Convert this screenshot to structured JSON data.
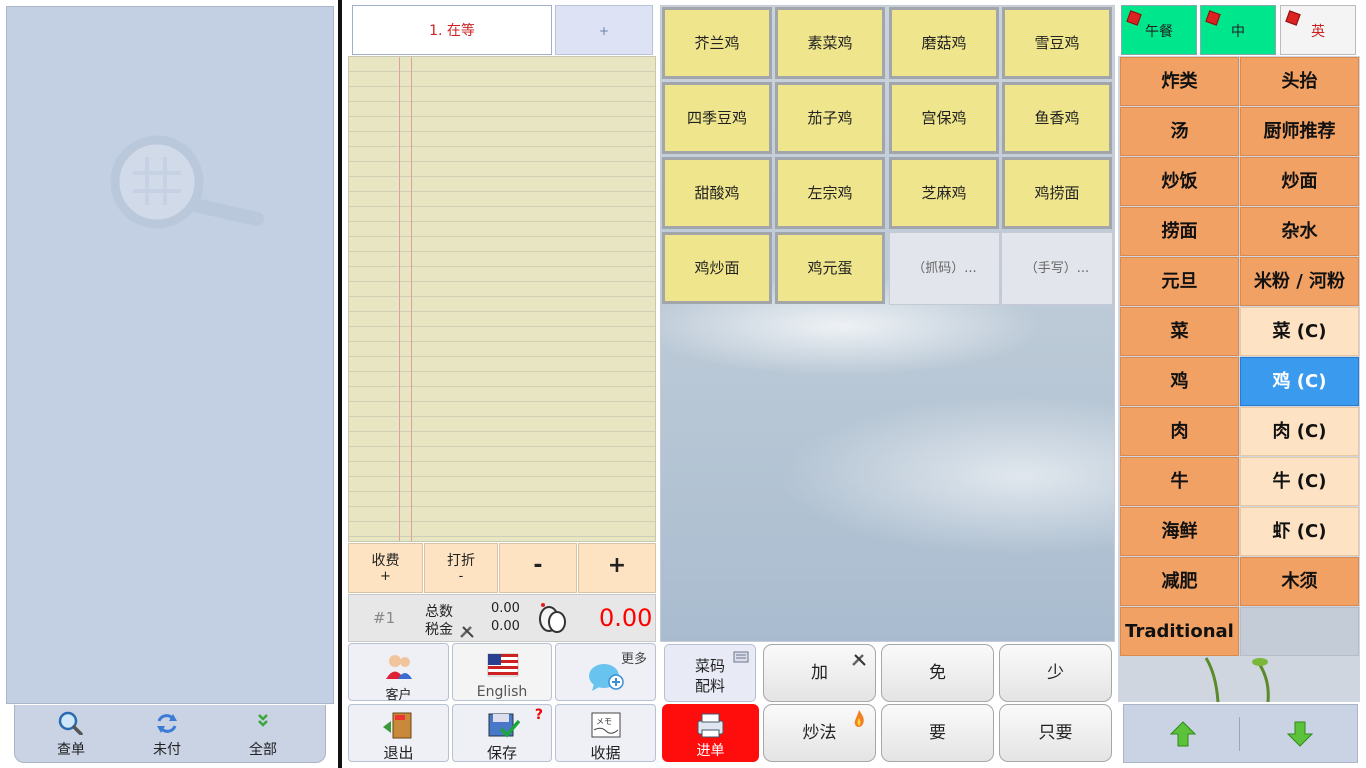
{
  "left_toolbar": {
    "buttons": [
      {
        "icon": "magnifier-icon",
        "label": "查单"
      },
      {
        "icon": "refresh-arrows-icon",
        "label": "未付"
      },
      {
        "icon": "double-chevron-down-icon",
        "label": "全部"
      }
    ]
  },
  "order": {
    "tab_label": "1. 在等",
    "add_tab_label": "+",
    "actions": [
      {
        "top": "收费",
        "bottom": "+"
      },
      {
        "top": "打折",
        "bottom": "-"
      },
      {
        "label": "-"
      },
      {
        "label": "+"
      }
    ],
    "totals": {
      "order_number": "#1",
      "total_label": "总数",
      "tax_label": "税金",
      "total_value": "0.00",
      "tax_value": "0.00",
      "grand_total": "0.00",
      "grand_total_color": "#ff0000"
    },
    "buttons_row1": [
      {
        "icon": "customer-icon",
        "label": "客户"
      },
      {
        "icon": "us-flag-icon",
        "label": "English"
      },
      {
        "icon": "chat-add-icon",
        "label": "",
        "corner": "更多"
      }
    ],
    "buttons_row2": [
      {
        "icon": "exit-door-icon",
        "label": "退出"
      },
      {
        "icon": "save-check-icon",
        "label": "保存",
        "corner": "?"
      },
      {
        "icon": "memo-receipt-icon",
        "label": "收据"
      }
    ]
  },
  "items": [
    [
      "芥兰鸡",
      "素菜鸡",
      "磨菇鸡",
      "雪豆鸡"
    ],
    [
      "四季豆鸡",
      "茄子鸡",
      "宫保鸡",
      "鱼香鸡"
    ],
    [
      "甜酸鸡",
      "左宗鸡",
      "芝麻鸡",
      "鸡捞面"
    ],
    [
      "鸡炒面",
      "鸡元蛋",
      "（抓码）...",
      "（手写）..."
    ]
  ],
  "modifiers": {
    "code_line1": "菜码",
    "code_line2": "配料",
    "send_label": "进单",
    "send_color": "#ff0d0d",
    "row1": [
      "加",
      "免",
      "少"
    ],
    "row2": [
      "炒法",
      "要",
      "只要"
    ]
  },
  "menu_tabs": [
    "午餐",
    "中",
    "英"
  ],
  "categories": [
    [
      {
        "label": "炸类",
        "style": "orange"
      },
      {
        "label": "头抬",
        "style": "orange"
      }
    ],
    [
      {
        "label": "汤",
        "style": "orange"
      },
      {
        "label": "厨师推荐",
        "style": "orange"
      }
    ],
    [
      {
        "label": "炒饭",
        "style": "orange"
      },
      {
        "label": "炒面",
        "style": "orange"
      }
    ],
    [
      {
        "label": "捞面",
        "style": "orange"
      },
      {
        "label": "杂水",
        "style": "orange"
      }
    ],
    [
      {
        "label": "元旦",
        "style": "orange"
      },
      {
        "label": "米粉 / 河粉",
        "style": "orange"
      }
    ],
    [
      {
        "label": "菜",
        "style": "orange"
      },
      {
        "label": "菜 (C)",
        "style": "light"
      }
    ],
    [
      {
        "label": "鸡",
        "style": "orange"
      },
      {
        "label": "鸡 (C)",
        "style": "selected"
      }
    ],
    [
      {
        "label": "肉",
        "style": "orange"
      },
      {
        "label": "肉 (C)",
        "style": "light"
      }
    ],
    [
      {
        "label": "牛",
        "style": "orange"
      },
      {
        "label": "牛 (C)",
        "style": "light"
      }
    ],
    [
      {
        "label": "海鲜",
        "style": "orange"
      },
      {
        "label": "虾 (C)",
        "style": "light"
      }
    ],
    [
      {
        "label": "减肥",
        "style": "orange"
      },
      {
        "label": "木须",
        "style": "orange"
      }
    ],
    [
      {
        "label": "Traditional",
        "style": "orange"
      },
      {
        "label": "",
        "style": "blank"
      }
    ]
  ],
  "colors": {
    "category_orange": "#f1a164",
    "category_selected": "#3a9aee",
    "item_yellow": "#efe58c",
    "menu_tab_green": "#00e68c"
  }
}
